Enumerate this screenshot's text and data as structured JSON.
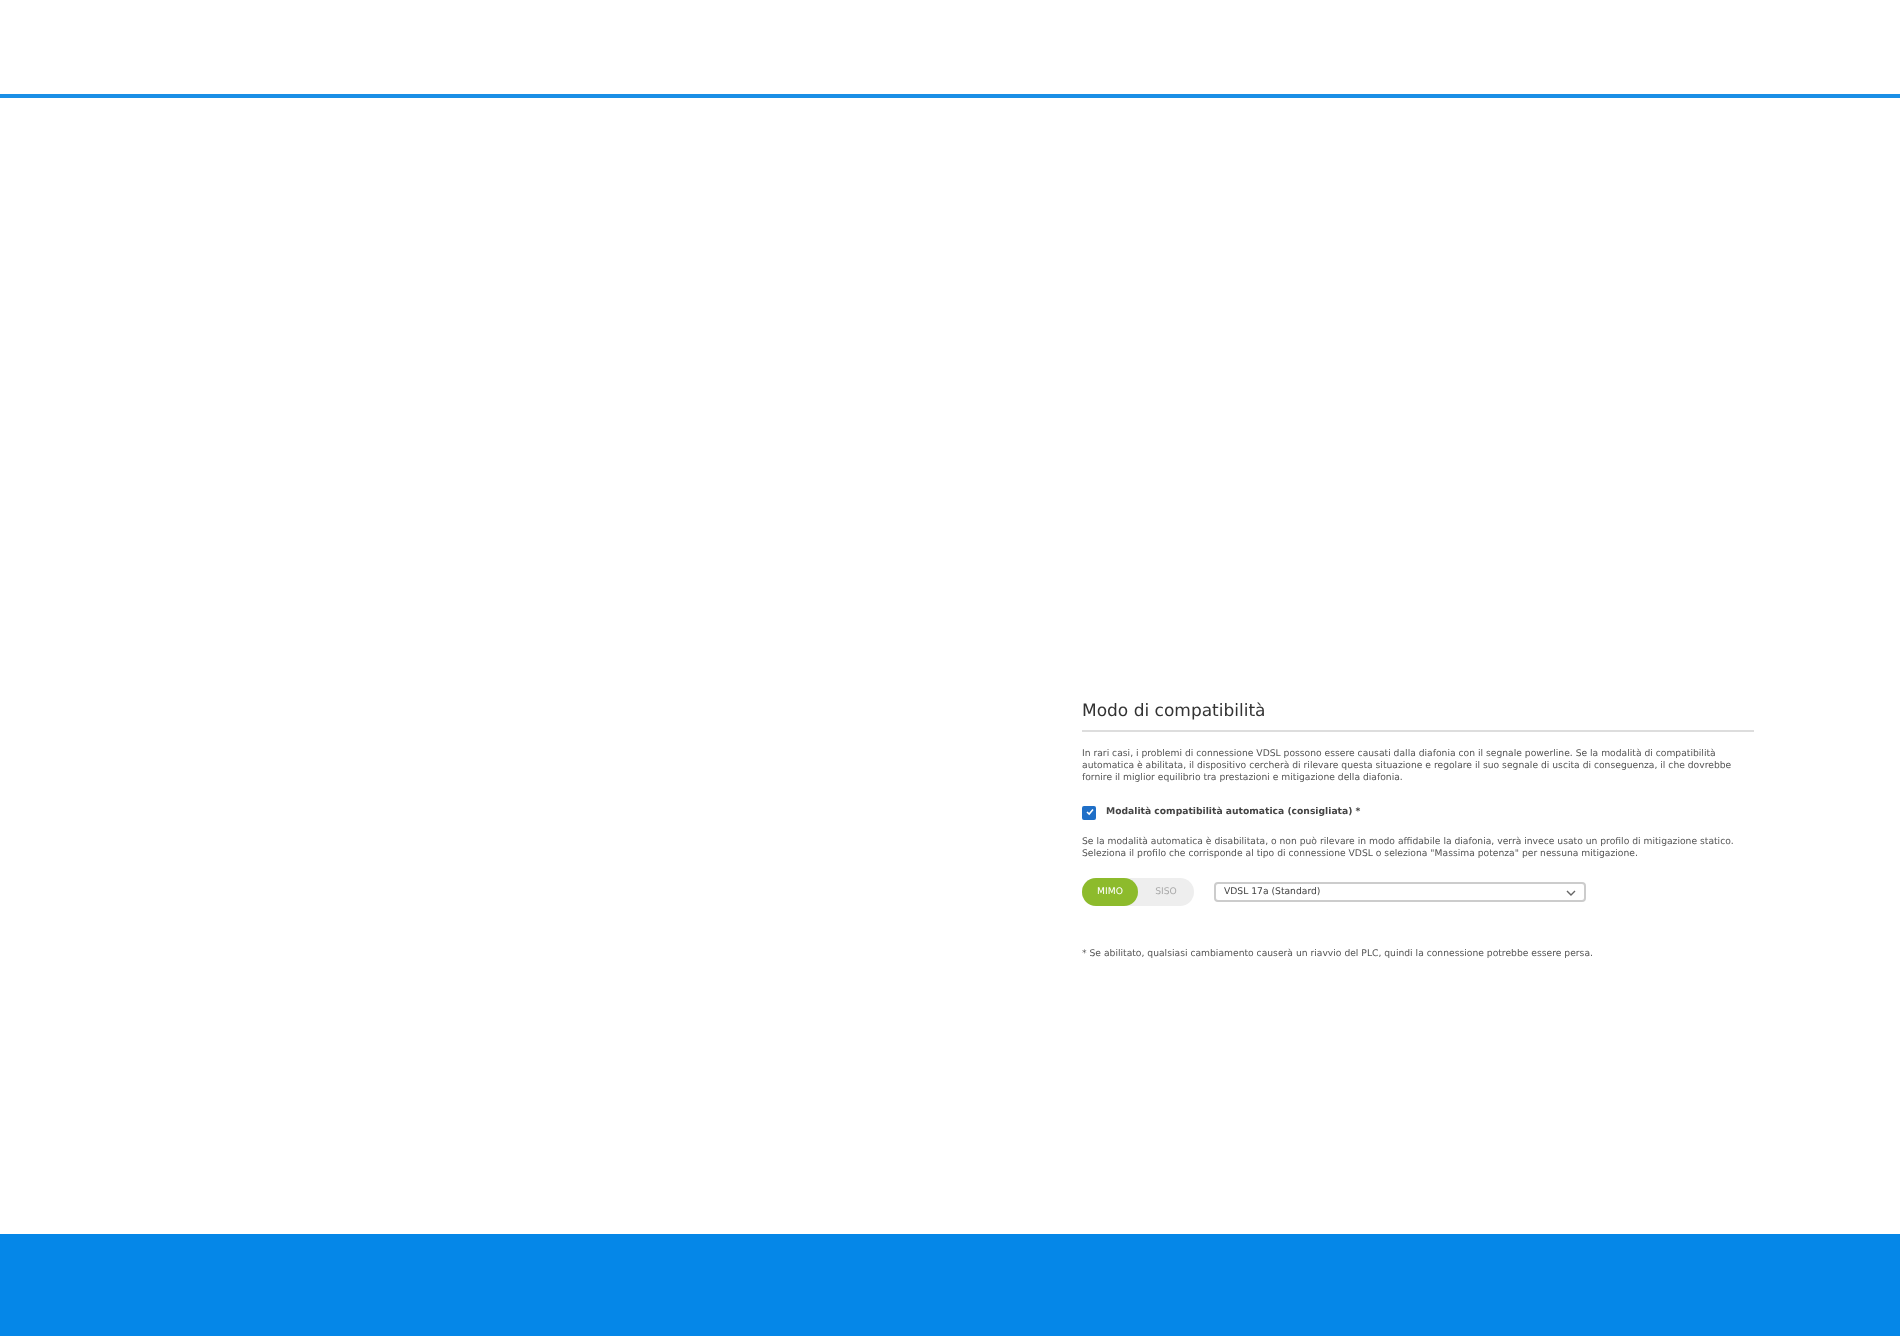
{
  "section": {
    "title": "Modo di compatibilità",
    "description": "In rari casi, i problemi di connessione VDSL possono essere causati dalla diafonia con il segnale powerline. Se la modalità di compatibilità automatica è abilitata, il dispositivo cercherà di rilevare questa situazione e regolare il suo segnale di uscita di conseguenza, il che dovrebbe fornire il miglior equilibrio tra prestazioni e mitigazione della diafonia.",
    "auto_mode": {
      "label": "Modalità compatibilità automatica (consigliata) *",
      "checked": true
    },
    "manual_hint": "Se la modalità automatica è disabilitata, o non può rilevare in modo affidabile la diafonia, verrà invece usato un profilo di mitigazione statico. Seleziona il profilo che corrisponde al tipo di connessione VDSL o seleziona \"Massima potenza\" per nessuna mitigazione.",
    "toggle": [
      {
        "label": "MIMO",
        "selected": true
      },
      {
        "label": "SISO",
        "selected": false
      }
    ],
    "profile": {
      "value": "VDSL 17a (Standard)"
    },
    "footnote": "* Se abilitato, qualsiasi cambiamento causerà un riavvio del PLC, quindi la connessione potrebbe essere persa."
  }
}
